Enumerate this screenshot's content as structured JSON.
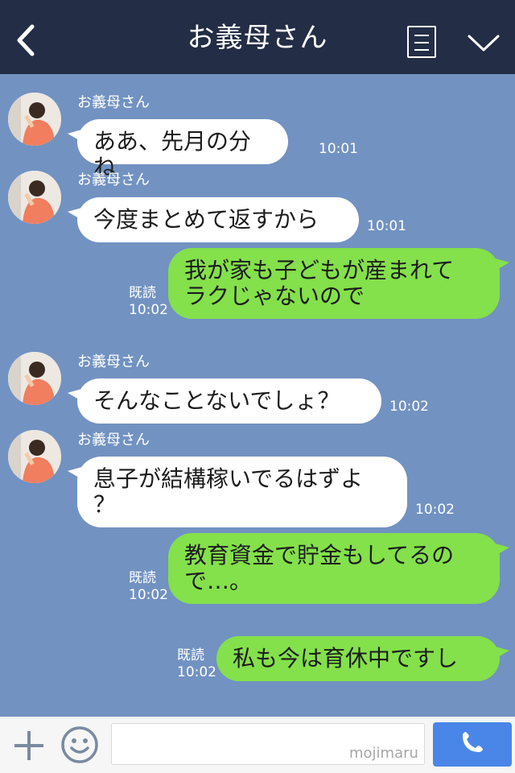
{
  "header": {
    "title": "お義母さん",
    "back_icon": "chevron-left-icon",
    "menu_icon": "menu-list-icon",
    "expand_icon": "chevron-down-icon"
  },
  "colors": {
    "header_bg": "#232d45",
    "chat_bg": "#7292c1",
    "incoming_bubble": "#ffffff",
    "outgoing_bubble": "#84e04b",
    "send_button": "#4a86e8"
  },
  "messages": [
    {
      "direction": "in",
      "sender": "お義母さん",
      "lines": [
        "ああ、先月の分ね"
      ],
      "time": "10:01"
    },
    {
      "direction": "in",
      "sender": "お義母さん",
      "lines": [
        "今度まとめて返すから"
      ],
      "time": "10:01"
    },
    {
      "direction": "out",
      "lines": [
        "我が家も子どもが産まれて",
        "ラクじゃないので"
      ],
      "read": "既読",
      "time": "10:02"
    },
    {
      "direction": "in",
      "sender": "お義母さん",
      "lines": [
        "そんなことないでしょ？"
      ],
      "time": "10:02"
    },
    {
      "direction": "in",
      "sender": "お義母さん",
      "lines": [
        "息子が結構稼いでるはずよ",
        "？"
      ],
      "time": "10:02"
    },
    {
      "direction": "out",
      "lines": [
        "教育資金で貯金もしてるの",
        "で…。"
      ],
      "read": "既読",
      "time": "10:02"
    },
    {
      "direction": "out",
      "lines": [
        "私も今は育休中ですし"
      ],
      "read": "既読",
      "time": "10:02"
    }
  ],
  "input": {
    "value": "",
    "watermark": "mojimaru",
    "plus_icon": "plus-icon",
    "emoji_icon": "smiley-icon",
    "send_icon": "phone-icon"
  }
}
